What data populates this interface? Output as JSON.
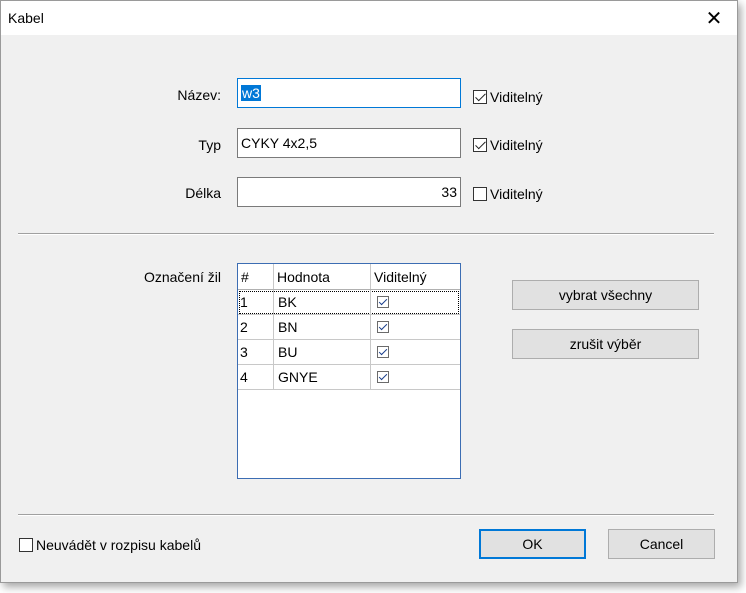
{
  "window": {
    "title": "Kabel",
    "close_symbol": "✕"
  },
  "form": {
    "name_label": "Název:",
    "name_value": "w3",
    "type_label": "Typ",
    "type_value": "CYKY 4x2,5",
    "length_label": "Délka",
    "length_value": "33",
    "visible_label": "Viditelný",
    "name_visible": true,
    "type_visible": true,
    "length_visible": false
  },
  "cores": {
    "label": "Označení žil",
    "columns": [
      "#",
      "Hodnota",
      "Viditelný"
    ],
    "rows": [
      {
        "num": "1",
        "value": "BK",
        "visible": true
      },
      {
        "num": "2",
        "value": "BN",
        "visible": true
      },
      {
        "num": "3",
        "value": "BU",
        "visible": true
      },
      {
        "num": "4",
        "value": "GNYE",
        "visible": true
      }
    ]
  },
  "buttons": {
    "select_all": "vybrat všechny",
    "deselect": "zrušit výběr",
    "ok": "OK",
    "cancel": "Cancel"
  },
  "footer": {
    "omit_label": "Neuvádět v rozpisu kabelů",
    "omit_checked": false
  }
}
